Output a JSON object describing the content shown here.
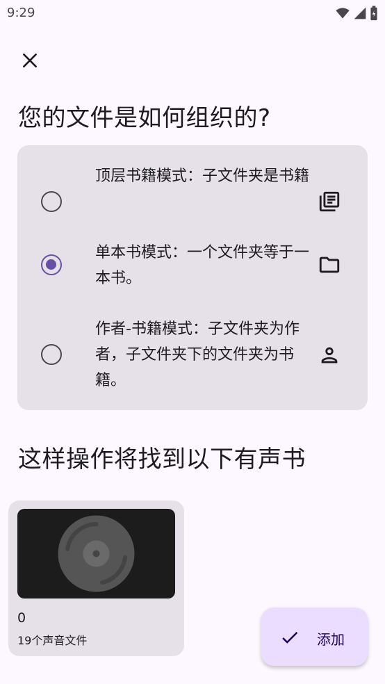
{
  "status_bar": {
    "time": "9:29"
  },
  "question": "您的文件是如何组织的?",
  "options": [
    {
      "label": "顶层书籍模式：子文件夹是书籍",
      "selected": false,
      "icon": "library-books-icon"
    },
    {
      "label": "单本书模式：一个文件夹等于一本书。",
      "selected": true,
      "icon": "folder-icon"
    },
    {
      "label": "作者-书籍模式：子文件夹为作者，子文件夹下的文件夹为书籍。",
      "selected": false,
      "icon": "person-icon"
    }
  ],
  "found_heading": "这样操作将找到以下有声书",
  "books": [
    {
      "title": "0",
      "subtitle": "19个声音文件"
    }
  ],
  "fab": {
    "label": "添加"
  },
  "colors": {
    "accent": "#6750A4",
    "surface": "#E6E0E9",
    "background": "#FDF7FF",
    "fab": "#EADDFF"
  }
}
